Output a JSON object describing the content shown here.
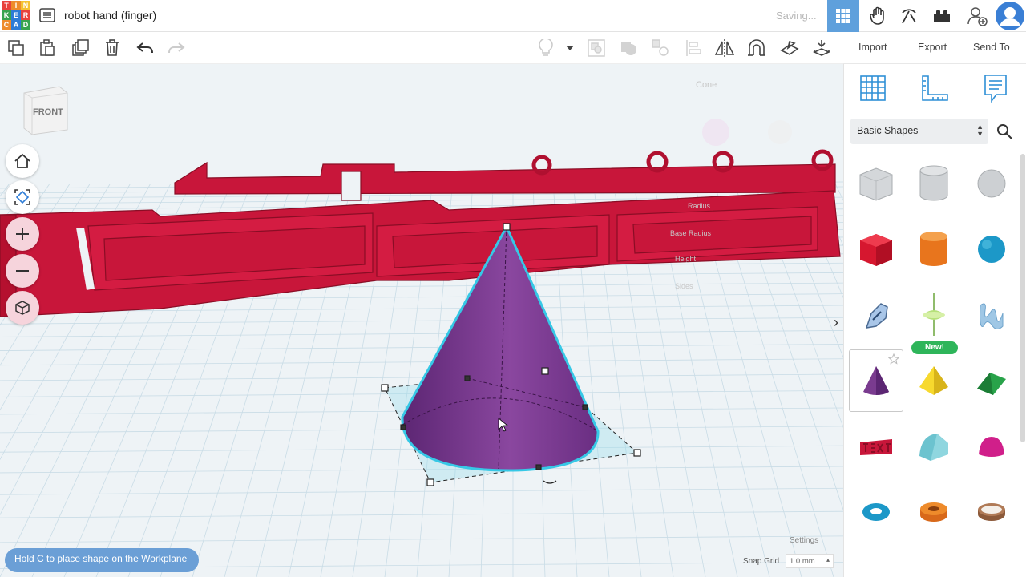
{
  "app": {
    "logo_letters": [
      "T",
      "I",
      "N",
      "K",
      "E",
      "R",
      "C",
      "A",
      "D"
    ],
    "logo_colors": [
      "#e8423c",
      "#ee8b2b",
      "#f5c231",
      "#37a44f",
      "#2e7cd6",
      "#e8423c",
      "#ee8b2b",
      "#2e7cd6",
      "#37a44f"
    ]
  },
  "header": {
    "title": "robot hand (finger)",
    "status": "Saving...",
    "icons": [
      "grid-view-icon",
      "tinker-hand-icon",
      "pickaxe-icon",
      "bricks-icon",
      "add-user-icon",
      "avatar"
    ]
  },
  "toolbar": {
    "left_icons": [
      "copy-icon",
      "paste-icon",
      "duplicate-icon",
      "delete-icon",
      "undo-icon",
      "redo-icon"
    ],
    "right_icons": [
      "light-bulb-icon",
      "dropdown-caret-icon",
      "group-icon",
      "solid-icon",
      "ungroup-icon",
      "align-icon",
      "mirror-icon",
      "cruise-icon",
      "workplane-icon",
      "drop-icon"
    ]
  },
  "right_tabs": {
    "import": "Import",
    "export": "Export",
    "send_to": "Send To"
  },
  "viewport": {
    "viewcube_label": "FRONT",
    "ghost_panel": {
      "title": "Cone",
      "radius": "Radius",
      "base_radius": "Base Radius",
      "height": "Height",
      "sides": "Sides"
    },
    "hint": "Hold C to place shape on the Workplane",
    "settings": "Settings",
    "snap_grid_label": "Snap Grid",
    "snap_grid_value": "1.0 mm",
    "colors": {
      "grid_bg": "#eef3f6",
      "links": "#c8163a",
      "cone": "#7a3b8f",
      "selection": "#36c8e6"
    }
  },
  "sidebar": {
    "panel_icons": [
      "workplane-grid-icon",
      "ruler-icon",
      "notes-icon"
    ],
    "category": "Basic Shapes",
    "new_badge": "New!",
    "shapes": [
      "box-hole",
      "cylinder-hole",
      "sphere-hole",
      "box",
      "cylinder",
      "sphere",
      "scribble",
      "spinning-top",
      "shape-generator",
      "cone",
      "pyramid",
      "roof",
      "text",
      "half-cylinder",
      "paraboloid",
      "torus",
      "tube",
      "ring"
    ]
  }
}
